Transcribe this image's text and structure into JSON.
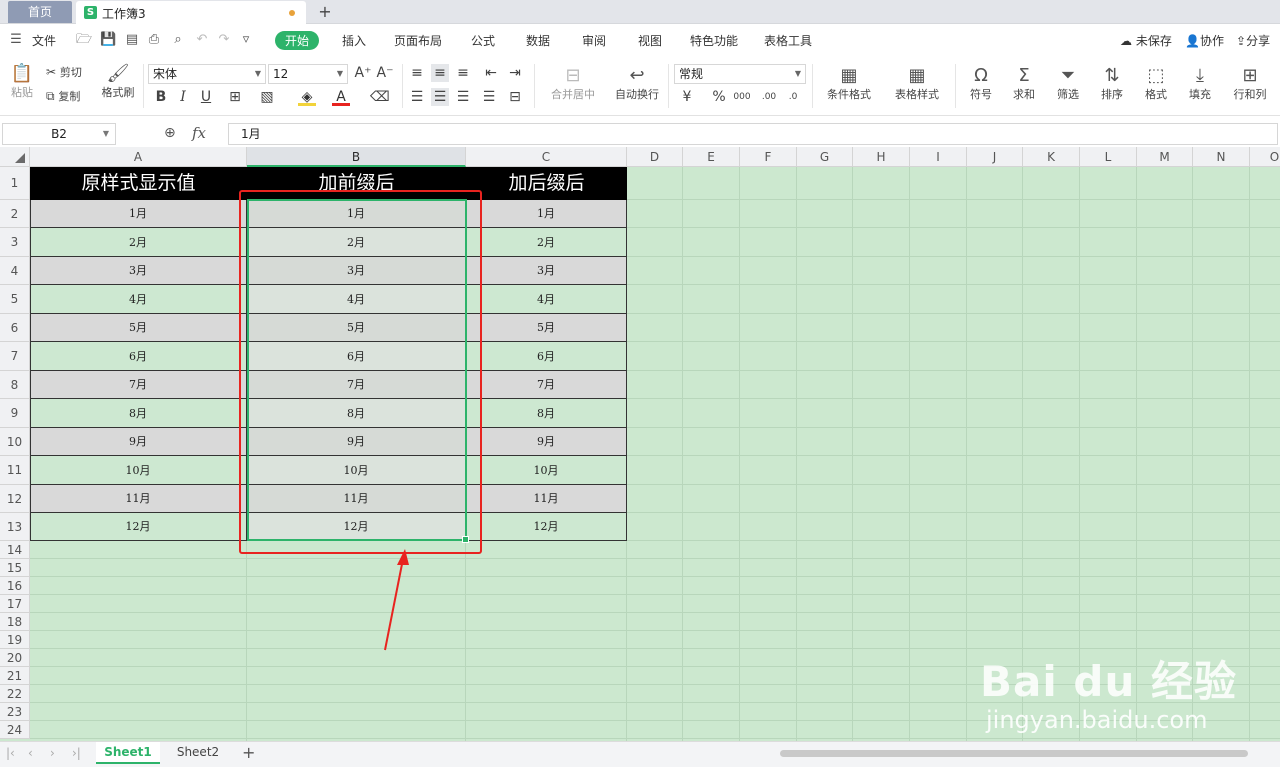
{
  "tabs": {
    "home": "首页",
    "workbook": "工作簿3",
    "add": "+"
  },
  "menu": {
    "file": "文件",
    "tabs": [
      "开始",
      "插入",
      "页面布局",
      "公式",
      "数据",
      "审阅",
      "视图",
      "特色功能",
      "表格工具"
    ],
    "unsaved": "未保存",
    "collaborate": "协作",
    "share": "分享"
  },
  "ribbon": {
    "paste": "粘贴",
    "cut": "剪切",
    "copy": "复制",
    "format_painter": "格式刷",
    "font_name": "宋体",
    "font_size": "12",
    "merge_center": "合并居中",
    "wrap_text": "自动换行",
    "number_format": "常规",
    "conditional_format": "条件格式",
    "table_style": "表格样式",
    "symbol": "符号",
    "sum": "求和",
    "filter": "筛选",
    "sort": "排序",
    "format": "格式",
    "fill": "填充",
    "row_col": "行和列"
  },
  "formula_bar": {
    "name_box": "B2",
    "fx": "fx",
    "content": "1月"
  },
  "columns": [
    "A",
    "B",
    "C",
    "D",
    "E",
    "F",
    "G",
    "H",
    "I",
    "J",
    "K",
    "L",
    "M",
    "N",
    "O"
  ],
  "rows": [
    "1",
    "2",
    "3",
    "4",
    "5",
    "6",
    "7",
    "8",
    "9",
    "10",
    "11",
    "12",
    "13",
    "14",
    "15",
    "16",
    "17",
    "18",
    "19",
    "20",
    "21",
    "22",
    "23",
    "24"
  ],
  "table": {
    "headers": [
      "原样式显示值",
      "加前缀后",
      "加后缀后"
    ],
    "values": [
      "1月",
      "2月",
      "3月",
      "4月",
      "5月",
      "6月",
      "7月",
      "8月",
      "9月",
      "10月",
      "11月",
      "12月"
    ]
  },
  "sheets": [
    "Sheet1",
    "Sheet2"
  ],
  "watermark": {
    "main": "Bai du 经验",
    "sub": "jingyan.baidu.com"
  },
  "colors": {
    "accent": "#2db36a",
    "grid_bg": "#cce8cf",
    "annotation": "#e8231f"
  }
}
